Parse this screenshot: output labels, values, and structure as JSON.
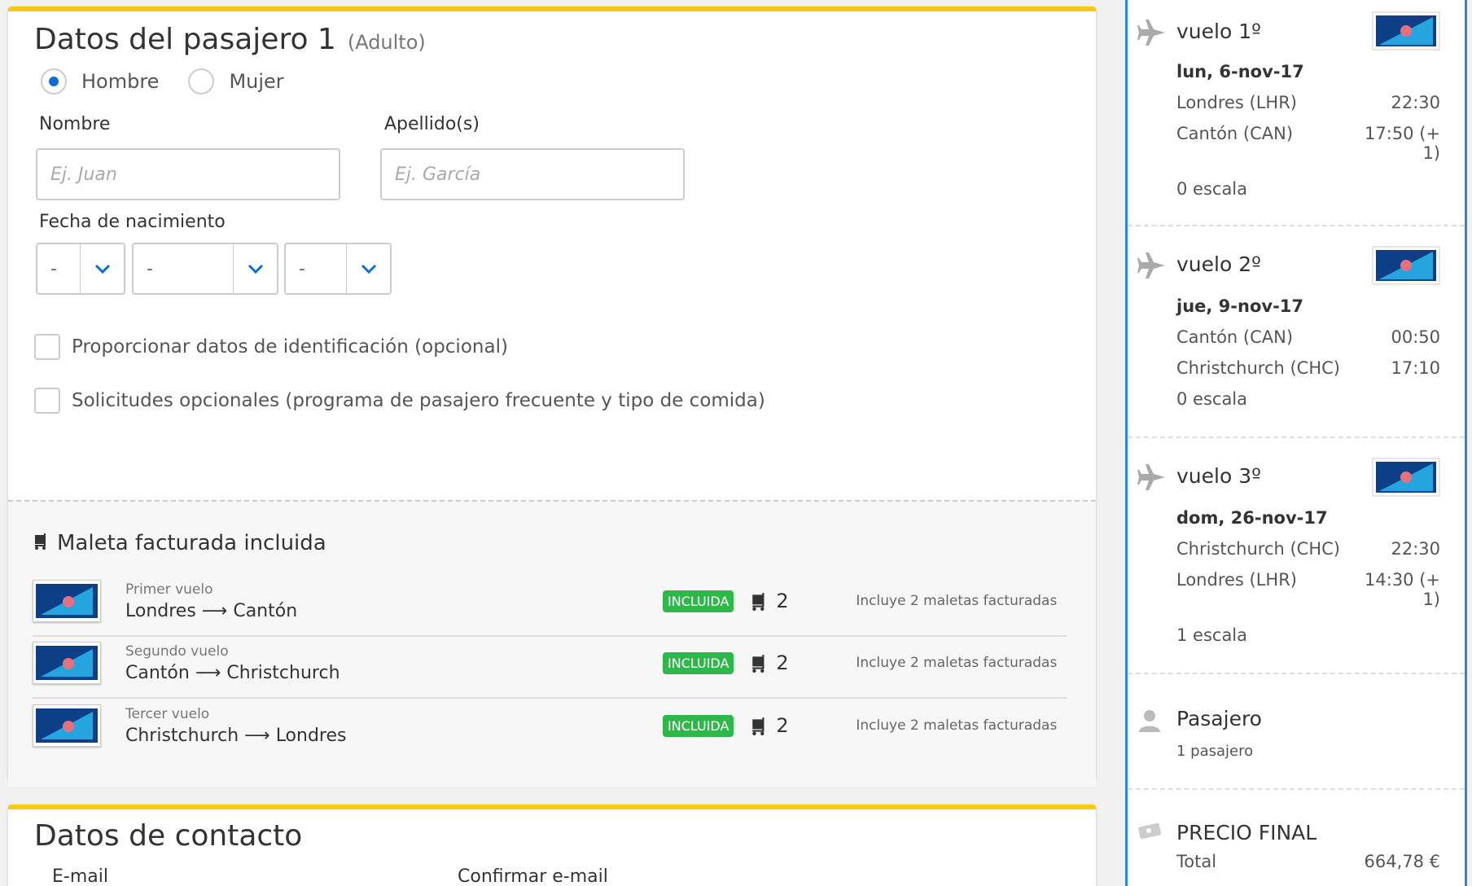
{
  "passenger": {
    "title": "Datos del pasajero 1",
    "type": "(Adulto)",
    "gender_male": "Hombre",
    "gender_female": "Mujer",
    "name_label": "Nombre",
    "name_placeholder": "Ej. Juan",
    "surname_label": "Apellido(s)",
    "surname_placeholder": "Ej. García",
    "dob_label": "Fecha de nacimiento",
    "dob_day": "-",
    "dob_month": "-",
    "dob_year": "-",
    "check_id": "Proporcionar datos de identificación (opcional)",
    "check_requests": "Solicitudes opcionales (programa de pasajero frecuente y tipo de comida)"
  },
  "baggage": {
    "title": "Maleta facturada incluida",
    "rows": [
      {
        "label": "Primer vuelo",
        "from": "Londres",
        "to": "Cantón",
        "badge": "INCLUIDA",
        "count": "2",
        "desc": "Incluye 2 maletas facturadas"
      },
      {
        "label": "Segundo vuelo",
        "from": "Cantón",
        "to": "Christchurch",
        "badge": "INCLUIDA",
        "count": "2",
        "desc": "Incluye 2 maletas facturadas"
      },
      {
        "label": "Tercer vuelo",
        "from": "Christchurch",
        "to": "Londres",
        "badge": "INCLUIDA",
        "count": "2",
        "desc": "Incluye 2 maletas facturadas"
      }
    ]
  },
  "contact": {
    "title": "Datos de contacto",
    "email_label": "E-mail",
    "confirm_label": "Confirmar e-mail"
  },
  "summary": {
    "legs": [
      {
        "title": "vuelo 1º",
        "date": "lun, 6-nov-17",
        "from": "Londres (LHR)",
        "dep": "22:30",
        "to": "Cantón (CAN)",
        "arr_a": "17:50 (+",
        "arr_b": "1)",
        "stops": "0 escala"
      },
      {
        "title": "vuelo 2º",
        "date": "jue, 9-nov-17",
        "from": "Cantón (CAN)",
        "dep": "00:50",
        "to": "Christchurch (CHC)",
        "arr": "17:10",
        "stops": "0 escala"
      },
      {
        "title": "vuelo 3º",
        "date": "dom, 26-nov-17",
        "from": "Christchurch (CHC)",
        "dep": "22:30",
        "to": "Londres (LHR)",
        "arr_a": "14:30 (+",
        "arr_b": "1)",
        "stops": "1 escala"
      }
    ],
    "pax_title": "Pasajero",
    "pax_count": "1 pasajero",
    "price_title": "PRECIO FINAL",
    "total_label": "Total",
    "total_value": "664,78 €"
  },
  "colors": {
    "accent": "#f5cb14",
    "link": "#0a6fd1",
    "panel_border": "#2b86e0",
    "badge": "#2fb84a"
  }
}
